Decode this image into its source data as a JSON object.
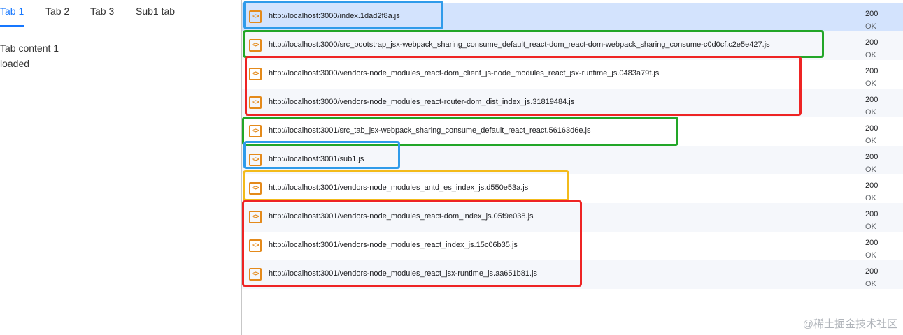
{
  "tabs": [
    "Tab 1",
    "Tab 2",
    "Tab 3",
    "Sub1 tab"
  ],
  "content": {
    "line1": "Tab content 1",
    "line2": "loaded"
  },
  "requests": [
    {
      "url": "http://localhost:3000/index.1dad2f8a.js",
      "status_code": "200",
      "status_text": "OK",
      "selected": true
    },
    {
      "url": "http://localhost:3000/src_bootstrap_jsx-webpack_sharing_consume_default_react-dom_react-dom-webpack_sharing_consume-c0d0cf.c2e5e427.js",
      "status_code": "200",
      "status_text": "OK"
    },
    {
      "url": "http://localhost:3000/vendors-node_modules_react-dom_client_js-node_modules_react_jsx-runtime_js.0483a79f.js",
      "status_code": "200",
      "status_text": "OK"
    },
    {
      "url": "http://localhost:3000/vendors-node_modules_react-router-dom_dist_index_js.31819484.js",
      "status_code": "200",
      "status_text": "OK"
    },
    {
      "url": "http://localhost:3001/src_tab_jsx-webpack_sharing_consume_default_react_react.56163d6e.js",
      "status_code": "200",
      "status_text": "OK"
    },
    {
      "url": "http://localhost:3001/sub1.js",
      "status_code": "200",
      "status_text": "OK"
    },
    {
      "url": "http://localhost:3001/vendors-node_modules_antd_es_index_js.d550e53a.js",
      "status_code": "200",
      "status_text": "OK"
    },
    {
      "url": "http://localhost:3001/vendors-node_modules_react-dom_index_js.05f9e038.js",
      "status_code": "200",
      "status_text": "OK"
    },
    {
      "url": "http://localhost:3001/vendors-node_modules_react_index_js.15c06b35.js",
      "status_code": "200",
      "status_text": "OK"
    },
    {
      "url": "http://localhost:3001/vendors-node_modules_react_jsx-runtime_js.aa651b81.js",
      "status_code": "200",
      "status_text": "OK"
    }
  ],
  "file_icon": "script-file-icon",
  "highlight_colors": {
    "blue": "#2f9bea",
    "green": "#22a628",
    "red": "#ee2424",
    "yellow": "#f3bb1b"
  },
  "watermark": "@稀土掘金技术社区"
}
